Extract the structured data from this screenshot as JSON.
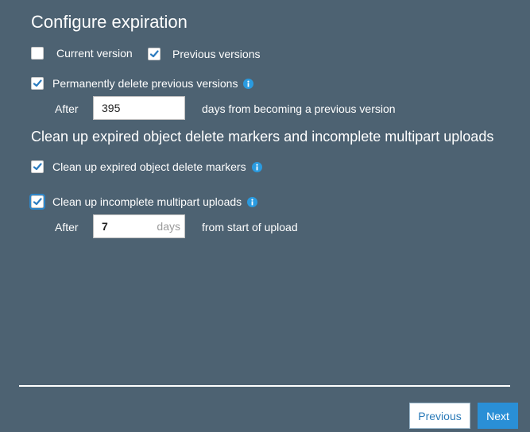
{
  "header": {
    "title": "Configure expiration"
  },
  "versions": {
    "current": {
      "label": "Current version",
      "checked": false
    },
    "previous": {
      "label": "Previous versions",
      "checked": true
    }
  },
  "permanent_delete": {
    "label": "Permanently delete previous versions",
    "checked": true,
    "after_label": "After",
    "days_value": "395",
    "suffix_text": "days from becoming a previous version"
  },
  "cleanup": {
    "section_title": "Clean up expired object delete markers and incomplete multipart uploads",
    "delete_markers": {
      "label": "Clean up expired object delete markers",
      "checked": true
    },
    "multipart": {
      "label": "Clean up incomplete multipart uploads",
      "checked": true,
      "after_label": "After",
      "days_value": "7",
      "days_unit": "days",
      "suffix_text": "from start of upload"
    }
  },
  "footer": {
    "previous_label": "Previous",
    "next_label": "Next"
  },
  "colors": {
    "background": "#4d6272",
    "accent": "#2a8fd6",
    "info": "#2a9be0",
    "check": "#2b7bbf"
  }
}
